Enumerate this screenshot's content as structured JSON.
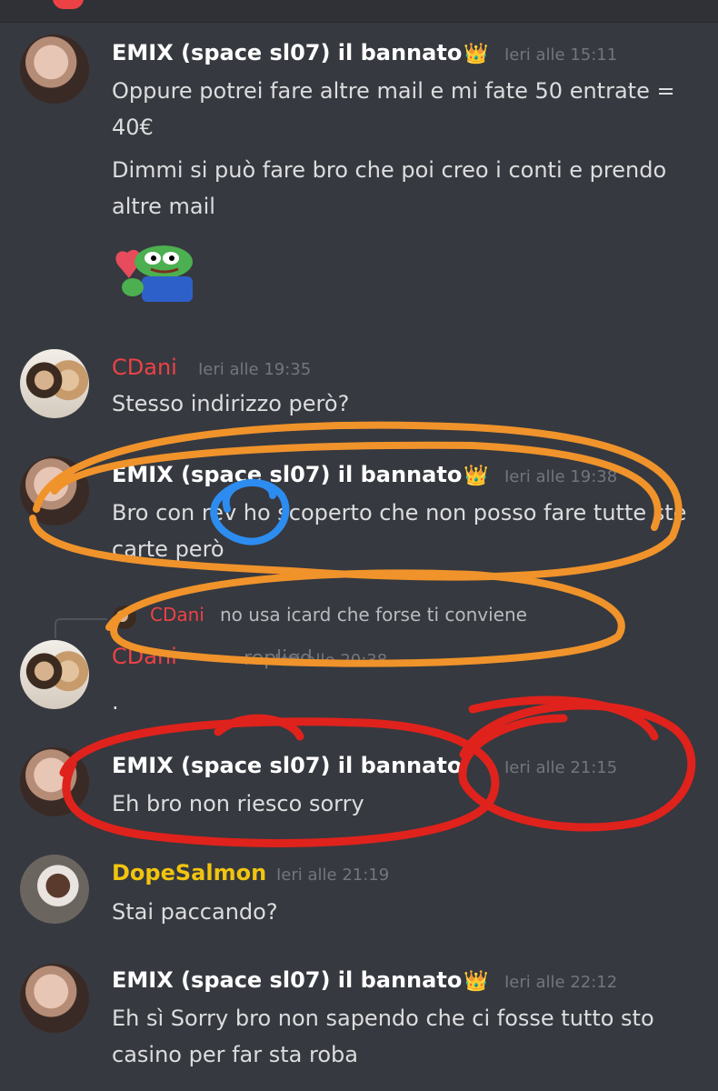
{
  "messages": [
    {
      "author": "EMIX (space sl07) il bannato",
      "crown": "👑",
      "timestamp": "Ieri alle 15:11",
      "lines": [
        "Oppure potrei fare altre mail e mi fate 50 entrate = 40€",
        "Dimmi si può fare bro che poi creo i conti e prendo altre mail"
      ],
      "sticker": "pepe-heart-sticker"
    },
    {
      "author": "CDani",
      "timestamp": "Ieri alle 19:35",
      "lines": [
        "Stesso indirizzo però?"
      ]
    },
    {
      "author": "EMIX (space sl07) il bannato",
      "crown": "👑",
      "timestamp": "Ieri alle 19:38",
      "lines": [
        "Bro con rev ho scoperto che non posso fare tutte ste carte però"
      ]
    },
    {
      "reply_to": {
        "author": "CDani",
        "text": "no usa icard che forse ti conviene"
      },
      "author": "CDani",
      "replied_label": "replied",
      "timestamp": "Ieri alle 20:38",
      "lines": [
        "."
      ]
    },
    {
      "author": "EMIX (space sl07) il bannato",
      "timestamp": "Ieri alle 21:15",
      "lines": [
        "Eh bro non riesco sorry"
      ]
    },
    {
      "author": "DopeSalmon",
      "timestamp": "Ieri alle 21:19",
      "lines": [
        "Stai paccando?"
      ]
    },
    {
      "author": "EMIX (space sl07) il bannato",
      "crown": "👑",
      "timestamp": "Ieri alle 22:12",
      "lines": [
        "Eh sì Sorry bro non sapendo che ci fosse tutto sto casino per far sta roba"
      ]
    }
  ],
  "colors": {
    "background": "#36393f",
    "emix_name": "#ffffff",
    "cdani_name": "#ed4245",
    "dopesalmon_name": "#f1c40f",
    "annotation_orange": "#f0932b",
    "annotation_blue": "#2d8cf0",
    "annotation_red": "#e0221c"
  }
}
